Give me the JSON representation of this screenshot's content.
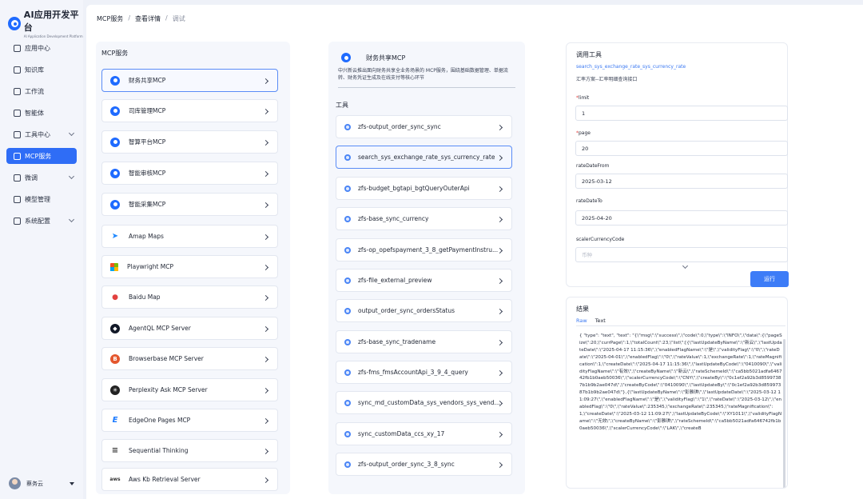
{
  "app": {
    "title": "AI应用开发平台",
    "subtitle": "AI Application Development Platform"
  },
  "sidebar": {
    "items": [
      {
        "label": "应用中心",
        "icon": "grid-icon",
        "active": false,
        "expandable": false
      },
      {
        "label": "知识库",
        "icon": "book-icon",
        "active": false,
        "expandable": false
      },
      {
        "label": "工作流",
        "icon": "workflow-icon",
        "active": false,
        "expandable": false
      },
      {
        "label": "智能体",
        "icon": "agent-icon",
        "active": false,
        "expandable": false
      },
      {
        "label": "工具中心",
        "icon": "wrench-icon",
        "active": false,
        "expandable": true
      },
      {
        "label": "MCP服务",
        "icon": "server-icon",
        "active": true,
        "expandable": false
      },
      {
        "label": "微调",
        "icon": "tune-icon",
        "active": false,
        "expandable": true
      },
      {
        "label": "模型管理",
        "icon": "model-icon",
        "active": false,
        "expandable": false
      },
      {
        "label": "系统配置",
        "icon": "settings-icon",
        "active": false,
        "expandable": true
      }
    ],
    "user": {
      "name": "蔡务云"
    }
  },
  "breadcrumb": {
    "root": "MCP服务",
    "sep": "/",
    "middle": "查看详情",
    "current": "调试"
  },
  "servers": {
    "title": "MCP服务",
    "items": [
      {
        "label": "财务共享MCP",
        "icon": "mcp-logo-icon"
      },
      {
        "label": "司库管理MCP",
        "icon": "mcp-logo-icon"
      },
      {
        "label": "智算平台MCP",
        "icon": "mcp-logo-icon"
      },
      {
        "label": "智能审核MCP",
        "icon": "mcp-logo-icon"
      },
      {
        "label": "智能采集MCP",
        "icon": "mcp-logo-icon"
      },
      {
        "label": "Amap Maps",
        "icon": "amap-icon"
      },
      {
        "label": "Playwright MCP",
        "icon": "playwright-icon"
      },
      {
        "label": "Baidu Map",
        "icon": "map-pin-icon"
      },
      {
        "label": "AgentQL MCP Server",
        "icon": "agentql-icon"
      },
      {
        "label": "Browserbase MCP Server",
        "icon": "browserbase-icon"
      },
      {
        "label": "Perplexity Ask MCP Server",
        "icon": "perplexity-icon"
      },
      {
        "label": "EdgeOne Pages MCP",
        "icon": "edgeone-icon"
      },
      {
        "label": "Sequential Thinking",
        "icon": "sequential-icon"
      },
      {
        "label": "Aws Kb Retrieval Server",
        "icon": "aws-icon"
      }
    ]
  },
  "detail": {
    "name": "财务共享MCP",
    "description": "中兴新云推出面向财务共享全业务场景的 MCP服务，围绕基础数据管理、单据流转、财务凭证生成及在线支付等核心环节",
    "tools_title": "工具",
    "tools": [
      "zfs-output_order_sync_sync",
      "search_sys_exchange_rate_sys_currency_rate",
      "zfs-budget_bgtapi_bgtQueryOuterApi",
      "zfs-base_sync_currency",
      "zfs-op_opefspayment_3_8_getPaymentInstru...",
      "zfs-file_external_preview",
      "output_order_sync_ordersStatus",
      "zfs-base_sync_tradename",
      "zfs-fms_fmsAccountApi_3_9_4_query",
      "sync_md_customData_sys_vendors_sys_vend...",
      "sync_customData_ccs_xy_17",
      "zfs-output_order_sync_3_8_sync"
    ]
  },
  "call": {
    "title": "调用工具",
    "tool_name": "search_sys_exchange_rate_sys_currency_rate",
    "tool_desc": "汇率方案--汇率明细查询接口",
    "fields": [
      {
        "label": "limit",
        "required": true,
        "value": "1",
        "placeholder": ""
      },
      {
        "label": "page",
        "required": true,
        "value": "20",
        "placeholder": ""
      },
      {
        "label": "rateDateFrom",
        "required": false,
        "value": "2025-03-12",
        "placeholder": ""
      },
      {
        "label": "rateDateTo",
        "required": false,
        "value": "2025-04-20",
        "placeholder": ""
      },
      {
        "label": "scalerCurrencyCode",
        "required": false,
        "value": "",
        "placeholder": "币种"
      }
    ],
    "run_label": "运行"
  },
  "result": {
    "title": "结果",
    "tabs": [
      "Raw",
      "Text"
    ],
    "active_tab": "Raw",
    "raw": "{ \"type\": \"text\", \"text\": \"{\\\"msg\\\":\\\"success\\\",\\\"code\\\":0,\\\"type\\\":\\\"INFO\\\",\\\"data\\\":{\\\"pageSize\\\":20,\\\"currPage\\\":1,\\\"totalCount\\\":23,\\\"list\\\":[{\\\"lastUpdateByName\\\":\\\"新云\\\",\\\"lastUpdateDate\\\":\\\"2025-04-17 11:15:36\\\",\\\"enabledFlagName\\\":\\\"是\\\",\\\"validityFlag\\\":\\\"0\\\",\\\"rateDate\\\":\\\"2025-04-01\\\",\\\"enabledFlag\\\":\\\"0\\\",\\\"rateValue\\\":1,\\\"exchangeRate\\\":1,\\\"rateMagnification\\\":1,\\\"createDate\\\":\\\"2025-04-17 11:15:36\\\",\\\"lastUpdateByCode\\\":\\\"0410090\\\",\\\"validityFlagName\\\":\\\"有效\\\",\\\"createByName\\\":\\\"新云\\\",\\\"rateSchemeId\\\":\\\"ca5bb5021adfa646742fb1b0aeb50036\\\",\\\"scalerCurrencyCode\\\":\\\"CNY\\\",\\\"createBy\\\":\\\"0c1ef2a92b3d85997387b1b9b2ae047d\\\",\\\"createByCode\\\":\\\"0410090\\\",\\\"lastUpdateBy\\\":\\\"0c1ef2a92b3d85997387b1b9b2ae047d\\\"},{\\\"lastUpdateByName\\\":\\\"彭雅琪\\\",\\\"lastUpdateDate\\\":\\\"2025-03-12 11:09:27\\\",\\\"enabledFlagName\\\":\\\"是\\\",\\\"validityFlag\\\":\\\"1\\\",\\\"rateDate\\\":\\\"2025-03-12\\\",\\\"enabledFlag\\\":\\\"0\\\",\\\"rateValue\\\":235345,\\\"exchangeRate\\\":235345,\\\"rateMagnification\\\":1,\\\"createDate\\\":\\\"2025-03-12 11:09:27\\\",\\\"lastUpdateByCode\\\":\\\"XY1011\\\",\\\"validityFlagName\\\":\\\"无效\\\",\\\"createByName\\\":\\\"彭雅琪\\\",\\\"rateSchemeId\\\":\\\"ca5bb5021adfa646742fb1b0aeb50036\\\",\\\"scalerCurrencyCode\\\":\\\"LAK\\\",\\\"createB"
  }
}
